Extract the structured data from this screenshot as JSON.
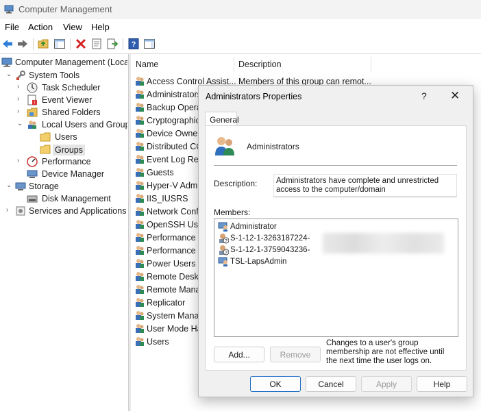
{
  "window": {
    "title": "Computer Management"
  },
  "menu": [
    "File",
    "Action",
    "View",
    "Help"
  ],
  "toolbar": {
    "buttons": [
      "back-icon",
      "forward-icon",
      "up-folder-icon",
      "show-hide-tree-icon",
      "delete-icon",
      "properties-icon",
      "export-list-icon",
      "help-icon",
      "show-hide-action-pane-icon"
    ]
  },
  "tree": {
    "root": "Computer Management (Local)",
    "system_tools": "System Tools",
    "task_scheduler": "Task Scheduler",
    "event_viewer": "Event Viewer",
    "shared_folders": "Shared Folders",
    "local_users_groups": "Local Users and Groups",
    "users": "Users",
    "groups": "Groups",
    "performance": "Performance",
    "device_manager": "Device Manager",
    "storage": "Storage",
    "disk_management": "Disk Management",
    "services_apps": "Services and Applications"
  },
  "list": {
    "headers": {
      "name": "Name",
      "description": "Description"
    },
    "rows": [
      {
        "name": "Access Control Assist...",
        "description": "Members of this group can remot..."
      },
      {
        "name": "Administrators",
        "description": ""
      },
      {
        "name": "Backup Operators",
        "description": ""
      },
      {
        "name": "Cryptographic Operators",
        "description": ""
      },
      {
        "name": "Device Owners",
        "description": ""
      },
      {
        "name": "Distributed COM Users",
        "description": ""
      },
      {
        "name": "Event Log Readers",
        "description": ""
      },
      {
        "name": "Guests",
        "description": ""
      },
      {
        "name": "Hyper-V Administrators",
        "description": ""
      },
      {
        "name": "IIS_IUSRS",
        "description": ""
      },
      {
        "name": "Network Configuration Operators",
        "description": ""
      },
      {
        "name": "OpenSSH Users",
        "description": ""
      },
      {
        "name": "Performance Log Users",
        "description": ""
      },
      {
        "name": "Performance Monitor Users",
        "description": ""
      },
      {
        "name": "Power Users",
        "description": ""
      },
      {
        "name": "Remote Desktop Users",
        "description": ""
      },
      {
        "name": "Remote Management Users",
        "description": ""
      },
      {
        "name": "Replicator",
        "description": ""
      },
      {
        "name": "System Managed Accounts Group",
        "description": ""
      },
      {
        "name": "User Mode Hardware Operators",
        "description": ""
      },
      {
        "name": "Users",
        "description": ""
      }
    ]
  },
  "dialog": {
    "title": "Administrators Properties",
    "help": "?",
    "close": "✕",
    "tab": "General",
    "group_name": "Administrators",
    "description_label": "Description:",
    "description_value": "Administrators have complete and unrestricted access to the computer/domain",
    "members_label": "Members:",
    "members": [
      {
        "name": "Administrator",
        "icon": "user-icon"
      },
      {
        "name": "S-1-12-1-3263187224-",
        "icon": "unknown-sid-icon"
      },
      {
        "name": "S-1-12-1-3759043236-",
        "icon": "unknown-sid-icon"
      },
      {
        "name": "TSL-LapsAdmin",
        "icon": "user-icon"
      }
    ],
    "add_label": "Add...",
    "remove_label": "Remove",
    "note": "Changes to a user's group membership are not effective until the next time the user logs on.",
    "ok_label": "OK",
    "cancel_label": "Cancel",
    "apply_label": "Apply",
    "help_label": "Help"
  },
  "colors": {
    "accent": "#1f6fc7",
    "dialog_bg": "#f0f0f0",
    "selection": "#e5e5e5"
  }
}
